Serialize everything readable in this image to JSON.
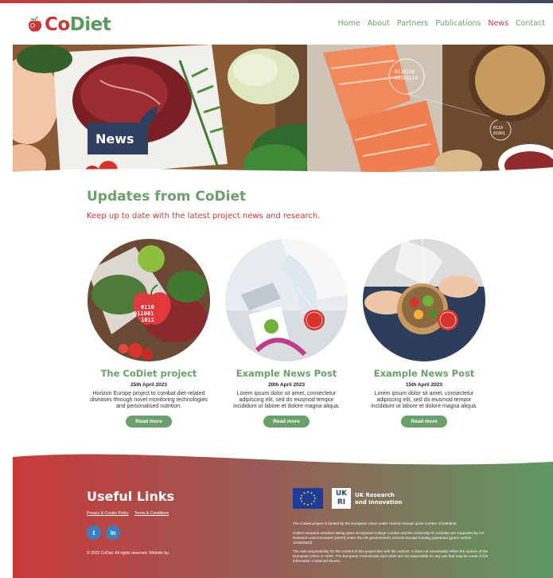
{
  "header": {
    "logo": {
      "part1": "Co",
      "part2": "Diet"
    },
    "nav": [
      "Home",
      "About",
      "Partners",
      "Publications",
      "News",
      "Contact"
    ],
    "active_nav": "News"
  },
  "hero": {
    "badge": "News",
    "overlay_codes": [
      "0110100",
      "01100110",
      "0110",
      "01001"
    ]
  },
  "section": {
    "title": "Updates from CoDiet",
    "subtitle": "Keep up to date with the latest project news and research."
  },
  "cards": [
    {
      "title": "The CoDiet project",
      "date": "25th April 2023",
      "text": "Horizon Europe project to combat diet-related diseases through novel monitoring technologies and personalised nutrition.",
      "button": "Read more",
      "image_codes": [
        "0110",
        "011001",
        "1011"
      ]
    },
    {
      "title": "Example News Post",
      "date": "20th April 2023",
      "text": "Lorem ipsum dolor sit amet, consectetur adipiscing elit, sed do eiusmod tempor incididunt ut labore et dolore magna aliqua.",
      "button": "Read more"
    },
    {
      "title": "Example News Post",
      "date": "15th April 2023",
      "text": "Lorem ipsum dolor sit amet, consectetur adipiscing elit, sed do eiusmod tempor incididunt ut labore et dolore magna aliqua.",
      "button": "Read more"
    }
  ],
  "footer": {
    "title": "Useful Links",
    "links": [
      "Privacy & Cookie Policy",
      "Terms & Conditions"
    ],
    "social": [
      {
        "icon": "twitter-icon",
        "glyph": "t"
      },
      {
        "icon": "linkedin-icon",
        "glyph": "in"
      }
    ],
    "copyright": "© 2023 CoDiet. All rights reserved. Website by:",
    "ukri": {
      "logo": "UK RI",
      "line1": "UK Research",
      "line2": "and Innovation"
    },
    "funding": [
      "The CoDiet project is funded by the European Union under Horizon Europe grant number 101084642.",
      "CoDiet research activities taking place at Imperial College London and the University of Leicester are supported by UK Research and Innovation (UKRI) under the UK government's Horizon Europe funding guarantee [grant number 101084642].",
      "The sole responsibility for the content of this project lies with the authors. It does not necessarily reflect the opinion of the European Union or UKRI. The European Commission and UKRI are not responsible for any use that may be made of the information contained therein."
    ]
  },
  "colors": {
    "green": "#6aa06a",
    "red": "#c8373a",
    "navy": "#2f3f60",
    "blue": "#3a7fbf"
  }
}
